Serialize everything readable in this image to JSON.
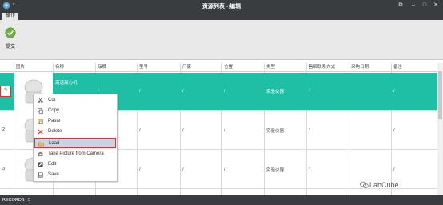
{
  "window": {
    "title": "资源列表 - 编辑",
    "minimize": "–",
    "maximize": "□",
    "close": "✕"
  },
  "ribbon": {
    "tab": "操作",
    "submit_label": "提交"
  },
  "grid": {
    "headers": [
      "图片",
      "名称",
      "品牌",
      "型号",
      "厂家",
      "位置",
      "类型",
      "售后联系方式",
      "采购日期",
      "备注"
    ],
    "rows": [
      {
        "num": "",
        "edit_glyph": "✎",
        "name": "高速离心机",
        "brand": "/",
        "model": "/",
        "maker": "/",
        "location": "/",
        "type": "实验仪器",
        "contact": "/",
        "date": "",
        "note": "/"
      },
      {
        "num": "2",
        "name": "",
        "brand": "/",
        "model": "/",
        "maker": "/",
        "location": "/",
        "type": "实验仪器",
        "contact": "/",
        "date": "",
        "note": "/"
      },
      {
        "num": "3",
        "name": "",
        "brand": "/",
        "model": "/",
        "maker": "/",
        "location": "/",
        "type": "实验仪器",
        "contact": "/",
        "date": "",
        "note": "/"
      }
    ]
  },
  "context_menu": {
    "items": [
      {
        "label": "Cut",
        "icon": "scissors-icon"
      },
      {
        "label": "Copy",
        "icon": "copy-icon"
      },
      {
        "label": "Paste",
        "icon": "paste-icon"
      },
      {
        "label": "Delete",
        "icon": "delete-icon"
      },
      {
        "label": "Load",
        "icon": "folder-icon",
        "highlighted": true
      },
      {
        "label": "Take Picture from Camera",
        "icon": "camera-icon"
      },
      {
        "label": "Edit",
        "icon": "edit-icon"
      },
      {
        "label": "Save",
        "icon": "save-icon"
      }
    ]
  },
  "status": {
    "records": "RECORDS : 5"
  },
  "watermark": {
    "text": "LabCube"
  },
  "colors": {
    "selected_row": "#1fbfa6",
    "highlight": "#c6d4e6",
    "alert_border": "#e0312f",
    "chrome": "#3a3d40"
  }
}
